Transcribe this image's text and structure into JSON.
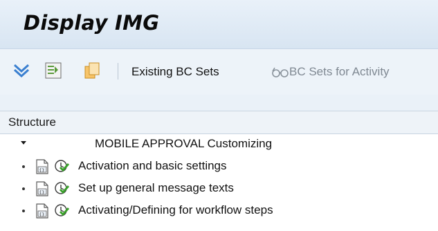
{
  "window": {
    "title": "Display IMG"
  },
  "toolbar": {
    "existing_bc_sets": "Existing BC Sets",
    "bc_sets_for_activity": "BC Sets for Activity",
    "icons": [
      "expand-all-icon",
      "where-used-icon",
      "copy-icon",
      "glasses-icon"
    ]
  },
  "tree": {
    "header": "Structure",
    "root": {
      "label": "MOBILE APPROVAL Customizing",
      "expanded": true
    },
    "items": [
      {
        "label": "Activation and basic settings"
      },
      {
        "label": "Set up general message texts"
      },
      {
        "label": "Activating/Defining for workflow steps"
      }
    ]
  },
  "colors": {
    "background": "#eaf1f8",
    "tree_background": "#ffffff",
    "disabled_text": "#7f8892",
    "accent_blue": "#3a7fd0"
  }
}
